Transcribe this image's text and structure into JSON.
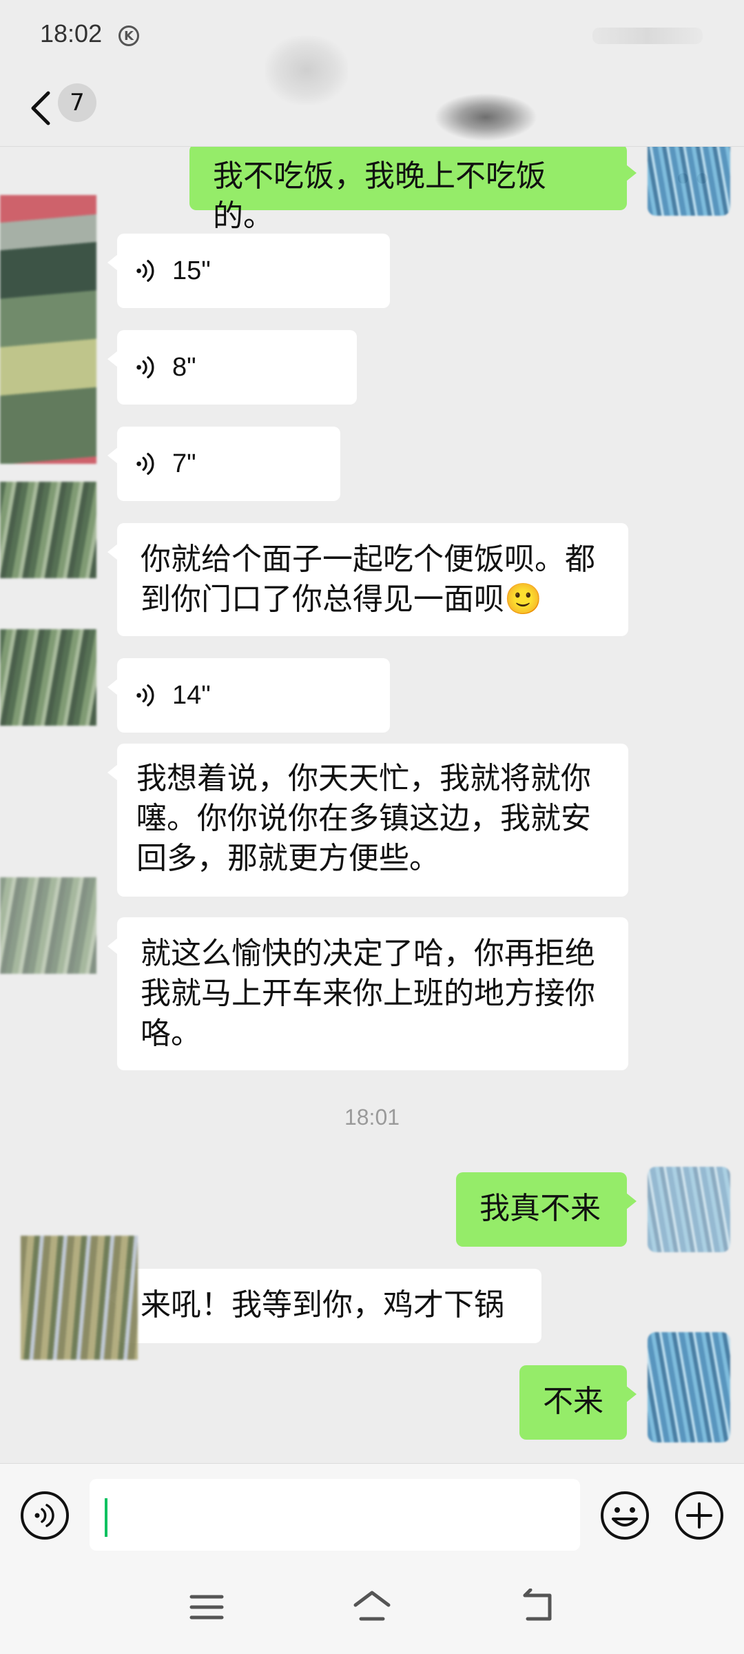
{
  "status_bar": {
    "time": "18:02",
    "k_badge": "K"
  },
  "header": {
    "back_count": "7"
  },
  "messages": {
    "m0": "我不吃饭，我晚上不吃饭的。",
    "v1": "15\"",
    "v2": "8\"",
    "v3": "7\"",
    "m4": "你就给个面子一起吃个便饭呗。都到你门口了你总得见一面呗🙂",
    "v5": "14\"",
    "m6": "我想着说，你天天忙，我就将就你噻。你你说你在多镇这边，我就安回多，那就更方便些。",
    "m7": "就这么愉快的决定了哈，你再拒绝我就马上开车来你上班的地方接你咯。",
    "time_divider": "18:01",
    "m8": "我真不来",
    "m9": "来吼！我等到你，鸡才下锅",
    "m10": "不来"
  },
  "input": {
    "value": ""
  },
  "colors": {
    "sent_bubble": "#95ec69",
    "received_bubble": "#ffffff",
    "background": "#ededed",
    "cursor": "#07c160"
  },
  "icons": [
    "back-icon",
    "voice-icon",
    "emoji-icon",
    "add-icon",
    "menu-icon",
    "home-icon",
    "back-nav-icon"
  ]
}
